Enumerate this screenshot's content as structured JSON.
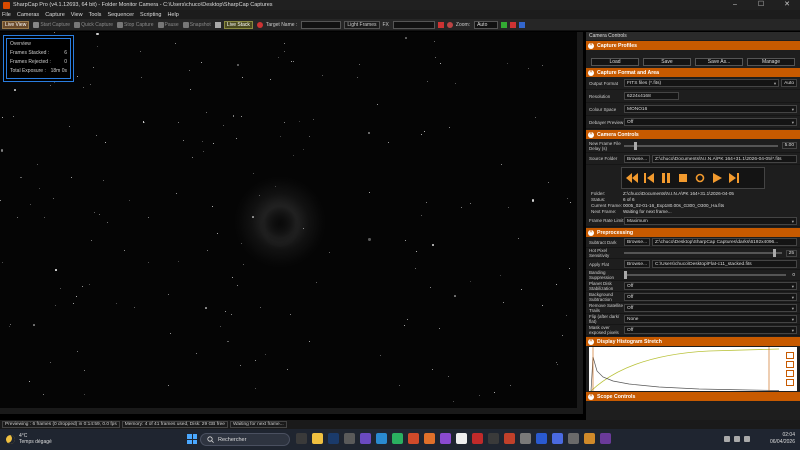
{
  "window": {
    "title": "SharpCap Pro (v4.1.12693, 64 bit) - Folder Monitor Camera - C:\\Users\\chuco\\Desktop\\SharpCap Captures",
    "controls": [
      "–",
      "☐",
      "✕"
    ]
  },
  "menu": [
    "File",
    "Cameras",
    "Capture",
    "View",
    "Tools",
    "Sequencer",
    "Scripting",
    "Help"
  ],
  "toolbar": {
    "live_view": "Live View",
    "start_capture": "Start Capture",
    "quick_capture": "Quick Capture",
    "stop_capture": "Stop Capture",
    "pause": "Pause",
    "snapshot": "Snapshot",
    "live_stack": "Live Stack",
    "target_name": "Target Name :",
    "light_frames": "Light Frames",
    "fx_label": "FX",
    "zoom_label": "Zoom:",
    "zoom_value": "Auto"
  },
  "overview": {
    "title": "Overview",
    "frames_stacked_label": "Frames Stacked :",
    "frames_stacked_value": "6",
    "frames_rejected_label": "Frames Rejected :",
    "frames_rejected_value": "0",
    "total_exposure_label": "Total Exposure :",
    "total_exposure_value": "18m 0s"
  },
  "panel": {
    "title": "Camera Controls",
    "capture_profiles": {
      "header": "Capture Profiles",
      "buttons": [
        "Load",
        "Save",
        "Save As...",
        "Manage"
      ]
    },
    "capture_format": {
      "header": "Capture Format and Area",
      "output_format_label": "Output Format",
      "output_format_value": "FITS files (*.fits)",
      "auto_label": "Auto",
      "resolution_label": "Resolution",
      "resolution_value": "6224x4168",
      "colour_space_label": "Colour Space",
      "colour_space_value": "MONO16",
      "debayer_label": "Debayer Preview",
      "debayer_value": "Off"
    },
    "camera_controls": {
      "header": "Camera Controls",
      "new_frame_label": "New Frame File Delay (s)",
      "new_frame_value": "5.00",
      "source_folder_label": "Source Folder",
      "browse_label": "Browse...",
      "source_folder_value": "Z:\\chuco\\Documents\\N.I.N.A\\PK 164+31.1\\2026-04-05\\*.fits",
      "folder_label": "Folder:",
      "folder_value": "Z:\\chuco\\Documents\\N.I.N.A\\PK 164+31.1\\2026-04-05",
      "status_label": "Status:",
      "status_value": "6 of 6",
      "current_frame_label": "Current Frame:",
      "current_frame_value": "0005_02-01-16_Exp180.00s_G300_O300_Ha.fits",
      "next_frame_label": "Next Frame:",
      "next_frame_value": "Waiting for next frame...",
      "frame_rate_label": "Frame Rate Limit",
      "frame_rate_value": "Maximum"
    },
    "preprocessing": {
      "header": "Preprocessing",
      "subtract_dark_label": "Subtract Dark",
      "subtract_dark_value": "Z:\\chuco\\Desktop\\SharpCap Captures\\darks\\6192x4096...",
      "hot_pixel_label": "Hot Pixel Sensitivity",
      "hot_pixel_value": "25",
      "apply_flat_label": "Apply Flat",
      "apply_flat_value": "C:\\Users\\chuco\\Desktop\\Flat-c11_stacked.fits",
      "banding_label": "Banding Suppression",
      "banding_value": "0",
      "planet_disk_label": "Planet Disk Stabilization",
      "planet_disk_value": "Off",
      "bg_sub_label": "Background Subtraction",
      "bg_sub_value": "Off",
      "satellite_label": "Remove Satellite Trails",
      "satellite_value": "Off",
      "flip_label": "Flip (after dark/ flat)",
      "flip_value": "None",
      "mask_label": "Mask over exposed pixels",
      "mask_value": "Off"
    },
    "histogram": {
      "header": "Display Histogram Stretch"
    },
    "scope": {
      "header": "Scope Controls"
    }
  },
  "status": {
    "previewing": "Previewing : 6 frames (0 dropped) in 0:14:59, 0.0 fps",
    "memory": "Memory: 4 of 41 frames used, Disk: 29 GB free",
    "waiting": "Waiting for next frame..."
  },
  "taskbar": {
    "temperature": "4°C",
    "weather": "Temps dégagé",
    "search_label": "Rechercher",
    "time": "02:04",
    "date": "06/04/2026"
  }
}
